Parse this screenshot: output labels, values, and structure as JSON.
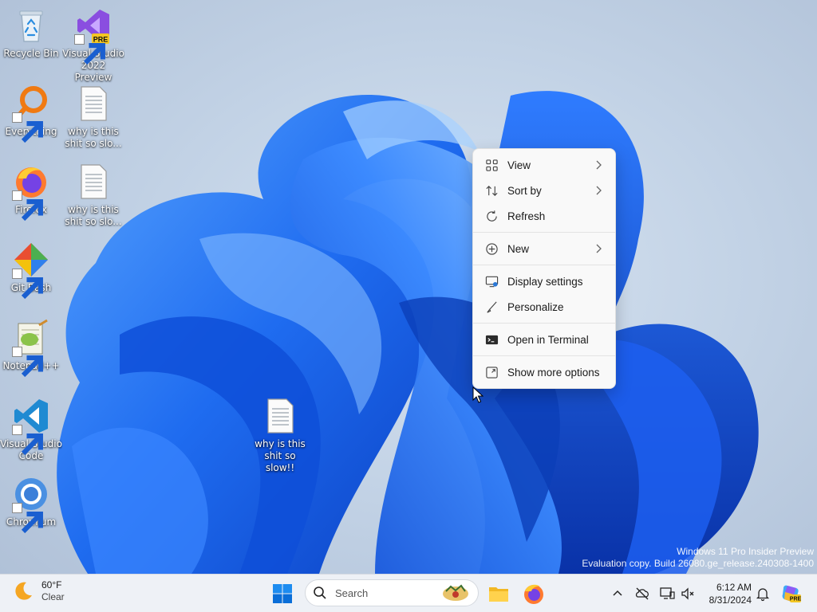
{
  "desktop": {
    "icons": [
      {
        "label": "Recycle Bin",
        "icon": "recycle-bin-icon"
      },
      {
        "label": "Visual Studio\n2022 Preview",
        "icon": "visual-studio-preview-icon",
        "badge": "PRE"
      },
      {
        "label": "Everything",
        "icon": "everything-search-icon"
      },
      {
        "label": "why is this\nshit so slo...",
        "icon": "text-document-icon"
      },
      {
        "label": "Firefox",
        "icon": "firefox-icon"
      },
      {
        "label": "why is this\nshit so slo...",
        "icon": "text-document-icon"
      },
      {
        "label": "Git Bash",
        "icon": "git-bash-icon"
      },
      {
        "label": "Notepad++",
        "icon": "notepad-plus-plus-icon"
      },
      {
        "label": "Visual Studio\nCode",
        "icon": "vscode-icon"
      },
      {
        "label": "Chromium",
        "icon": "chromium-icon"
      },
      {
        "label": "why is this\nshit so slow!!",
        "icon": "text-document-icon"
      }
    ]
  },
  "context_menu": {
    "items": [
      {
        "label": "View",
        "icon": "grid-view-icon",
        "submenu": true
      },
      {
        "label": "Sort by",
        "icon": "sort-arrows-icon",
        "submenu": true
      },
      {
        "label": "Refresh",
        "icon": "refresh-icon",
        "submenu": false
      },
      {
        "label": "New",
        "icon": "plus-circle-icon",
        "submenu": true
      },
      {
        "label": "Display settings",
        "icon": "display-settings-icon",
        "submenu": false
      },
      {
        "label": "Personalize",
        "icon": "brush-icon",
        "submenu": false
      },
      {
        "label": "Open in Terminal",
        "icon": "terminal-icon",
        "submenu": false
      },
      {
        "label": "Show more options",
        "icon": "expand-icon",
        "submenu": false
      }
    ]
  },
  "watermark": {
    "line1": "Windows 11 Pro Insider Preview",
    "line2": "Evaluation copy. Build 26080.ge_release.240308-1400"
  },
  "taskbar": {
    "weather": {
      "temp": "60°F",
      "condition": "Clear"
    },
    "search": {
      "placeholder": "Search"
    },
    "clock": {
      "time": "6:12 AM",
      "date": "8/31/2024"
    },
    "colors": {
      "accent": "#0078d4",
      "taskbar_bg": "#eef1f6"
    }
  }
}
